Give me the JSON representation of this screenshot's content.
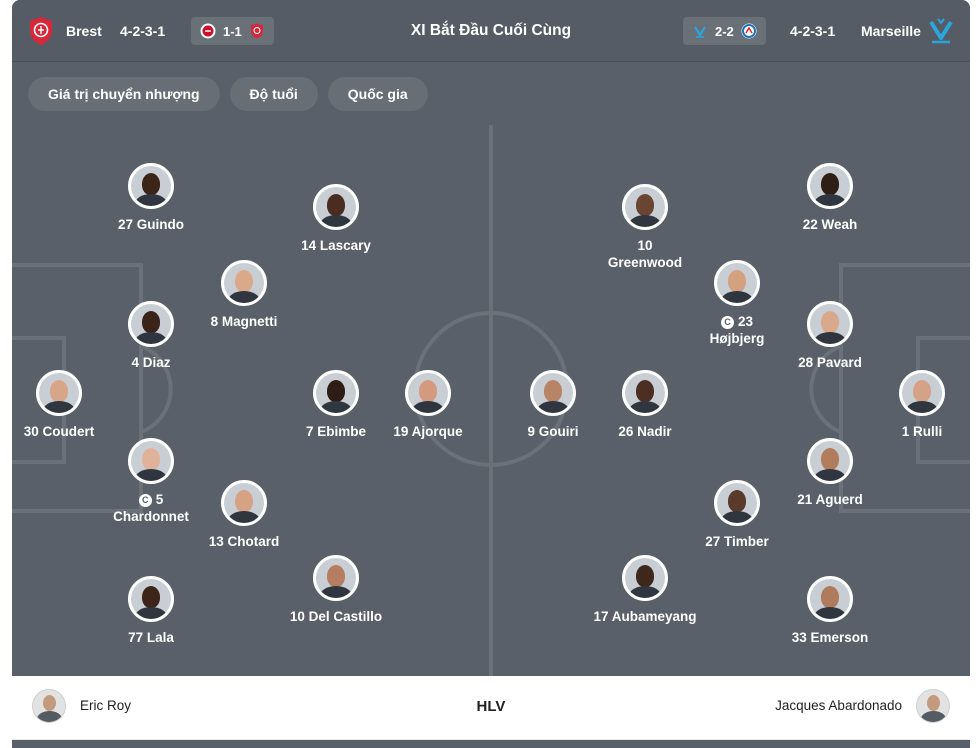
{
  "header": {
    "title": "XI Bắt Đầu Cuối Cùng",
    "home": {
      "name": "Brest",
      "formation": "4-2-3-1",
      "last_score": "1-1",
      "color": "#d6273b"
    },
    "away": {
      "name": "Marseille",
      "formation": "4-2-3-1",
      "last_score": "2-2",
      "color": "#2aa6dd"
    }
  },
  "filters": [
    "Giá trị chuyển nhượng",
    "Độ tuổi",
    "Quốc gia"
  ],
  "home_players": [
    {
      "number": "27",
      "name": "Guindo",
      "captain": false,
      "skin": "#3b2418"
    },
    {
      "number": "14",
      "name": "Lascary",
      "captain": false,
      "skin": "#4a2d20"
    },
    {
      "number": "8",
      "name": "Magnetti",
      "captain": false,
      "skin": "#d9a98a"
    },
    {
      "number": "4",
      "name": "Diaz",
      "captain": false,
      "skin": "#3a241a"
    },
    {
      "number": "30",
      "name": "Coudert",
      "captain": false,
      "skin": "#d7a689"
    },
    {
      "number": "7",
      "name": "Ebimbe",
      "captain": false,
      "skin": "#2e1d15"
    },
    {
      "number": "19",
      "name": "Ajorque",
      "captain": false,
      "skin": "#d49a80"
    },
    {
      "number": "5",
      "name": "Chardonnet",
      "captain": true,
      "skin": "#dfb39a"
    },
    {
      "number": "13",
      "name": "Chotard",
      "captain": false,
      "skin": "#d5a283"
    },
    {
      "number": "10",
      "name": "Del Castillo",
      "captain": false,
      "skin": "#b57e62"
    },
    {
      "number": "77",
      "name": "Lala",
      "captain": false,
      "skin": "#3c2519"
    }
  ],
  "away_players": [
    {
      "number": "10",
      "name": "Greenwood",
      "captain": false,
      "skin": "#6a4532"
    },
    {
      "number": "22",
      "name": "Weah",
      "captain": false,
      "skin": "#2f1e16"
    },
    {
      "number": "23",
      "name": "Højbjerg",
      "captain": true,
      "skin": "#d3a080"
    },
    {
      "number": "28",
      "name": "Pavard",
      "captain": false,
      "skin": "#d9a98b"
    },
    {
      "number": "9",
      "name": "Gouiri",
      "captain": false,
      "skin": "#b88466"
    },
    {
      "number": "26",
      "name": "Nadir",
      "captain": false,
      "skin": "#4a2f22"
    },
    {
      "number": "1",
      "name": "Rulli",
      "captain": false,
      "skin": "#d4a286"
    },
    {
      "number": "21",
      "name": "Aguerd",
      "captain": false,
      "skin": "#b27d5d"
    },
    {
      "number": "27",
      "name": "Timber",
      "captain": false,
      "skin": "#5a3a2a"
    },
    {
      "number": "17",
      "name": "Aubameyang",
      "captain": false,
      "skin": "#3e281c"
    },
    {
      "number": "33",
      "name": "Emerson",
      "captain": false,
      "skin": "#b07a5c"
    }
  ],
  "coaches": {
    "home": "Eric Roy",
    "label": "HLV",
    "away": "Jacques Abardonado"
  },
  "icons": {
    "captain": "C",
    "home_crest": "brest-crest-icon",
    "away_crest": "marseille-crest-icon",
    "lille_crest": "lille-crest-icon",
    "strasbourg_crest": "strasbourg-crest-icon"
  }
}
